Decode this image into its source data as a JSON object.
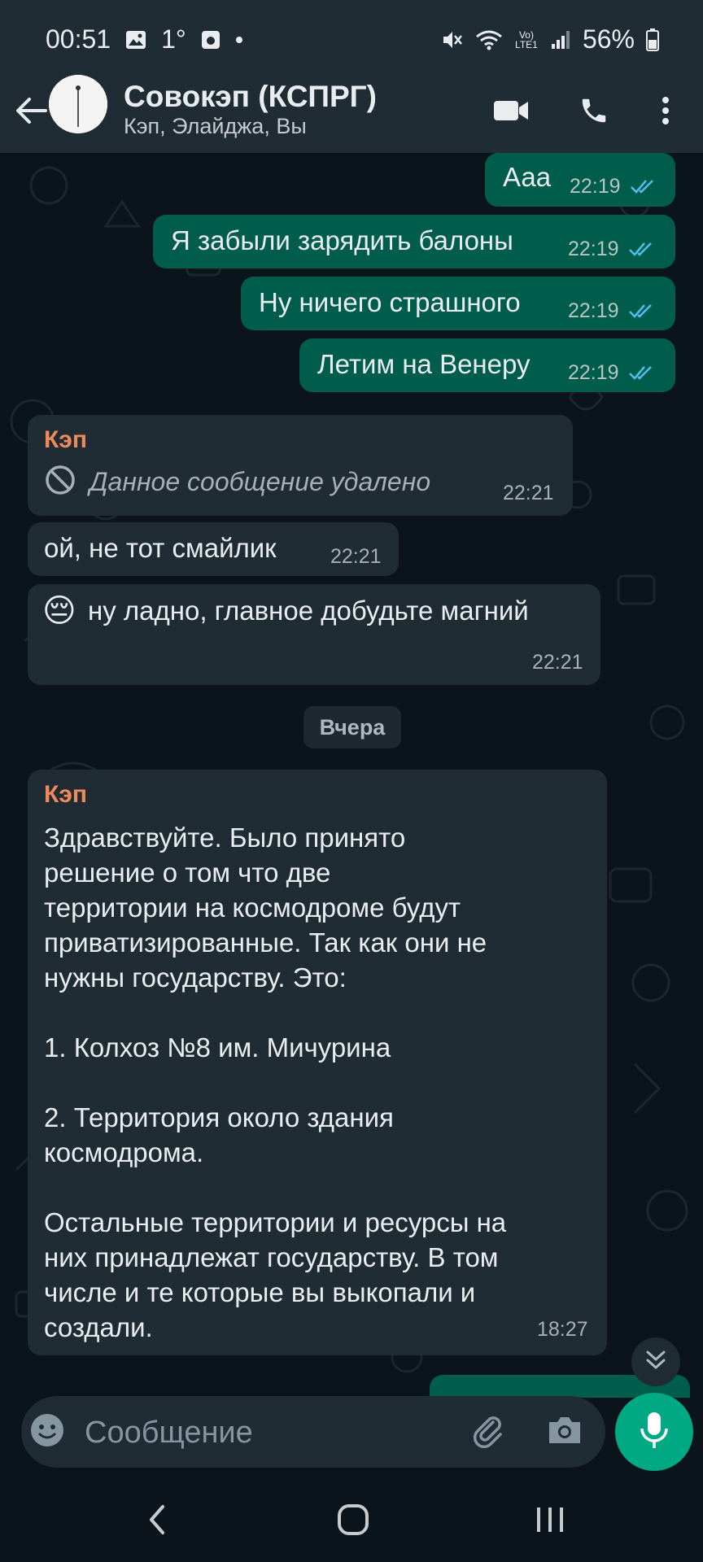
{
  "status_bar": {
    "time": "00:51",
    "temp": "1°",
    "battery": "56%",
    "net_label": "Vo) LTE1"
  },
  "header": {
    "title": "Совокэп (КСПРГ)",
    "subtitle": "Кэп, Элайджа, Вы"
  },
  "messages_out": [
    {
      "text": "Ааа",
      "time": "22:19"
    },
    {
      "text": "Я забыли зарядить балоны",
      "time": "22:19"
    },
    {
      "text": "Ну ничего страшного",
      "time": "22:19"
    },
    {
      "text": "Летим на Венеру",
      "time": "22:19"
    }
  ],
  "incoming": {
    "sender": "Кэп",
    "deleted_text": "Данное сообщение удалено",
    "deleted_time": "22:21",
    "msg2_text": "ой, не тот смайлик",
    "msg2_time": "22:21",
    "msg3_text": "ну ладно, главное добудьте магний",
    "msg3_emoji": "😔",
    "msg3_time": "22:21"
  },
  "date_chip": "Вчера",
  "long_message": {
    "sender": "Кэп",
    "text": "Здравствуйте. Было принято\nрешение о том что две\nтерритории на космодроме будут\nприватизированные. Так как они не\nнужны государству. Это:\n\n1. Колхоз №8 им. Мичурина\n\n2. Территория около здания\nкосмодрома.\n\nОстальные территории и ресурсы на\nних принадлежат государству. В том\nчисле и те которые вы выкопали и\nсоздали.",
    "time": "18:27"
  },
  "input": {
    "placeholder": "Сообщение"
  },
  "icons": {
    "back": "arrow-left-icon",
    "video": "video-call-icon",
    "call": "phone-icon",
    "menu": "more-vert-icon",
    "emoji": "emoji-icon",
    "attach": "attach-icon",
    "camera": "camera-icon",
    "mic": "mic-icon"
  },
  "colors": {
    "outgoing_bubble": "#005c4b",
    "incoming_bubble": "#1f2c34",
    "header": "#1f2c34",
    "accent": "#00a884",
    "sender_name": "#ef8a5c",
    "read_tick": "#53bdeb"
  }
}
